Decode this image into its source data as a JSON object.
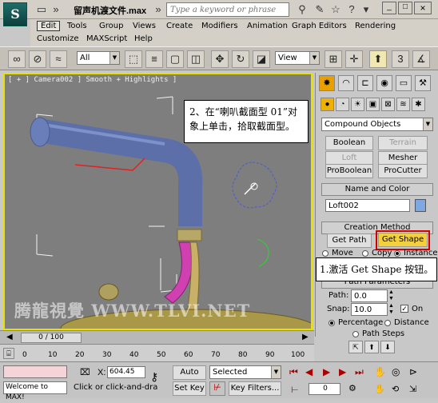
{
  "title_bar": {
    "title": "留声机渡文件.max",
    "search_placeholder": "Type a keyword or phrase"
  },
  "menu": {
    "row1": [
      "Edit",
      "Tools",
      "Group",
      "Views",
      "Create",
      "Modifiers",
      "Animation",
      "Graph Editors",
      "Rendering"
    ],
    "row2": [
      "Customize",
      "MAXScript",
      "Help"
    ]
  },
  "toolbar": {
    "selection_filter": "All",
    "reference_coord": "View"
  },
  "viewport": {
    "label": "[ + ] Camera002 ] Smooth + Highlights ]",
    "callout": "2、在“喇叭截面型 01”对象上单击，拾取截面型。",
    "watermark": "腾龍視覺 WWW.TLVI.NET"
  },
  "command_panel": {
    "category": "Compound Objects",
    "buttons": [
      "Boolean",
      "Terrain",
      "Loft",
      "Mesher",
      "ProBoolean",
      "ProCutter"
    ],
    "name_color_title": "Name and Color",
    "object_name": "Loft002",
    "object_color": "#7fa7e0",
    "creation_method_title": "Creation Method",
    "get_path": "Get Path",
    "get_shape": "Get Shape",
    "move_label": "Move",
    "copy_label": "Copy",
    "instance_label": "Instance",
    "callout": "1.激活 Get Shape 按钮。",
    "path_params_title": "Path Parameters",
    "path_label": "Path:",
    "path_value": "0.0",
    "snap_label": "Snap:",
    "snap_value": "10.0",
    "on_label": "On",
    "percentage_label": "Percentage",
    "distance_label": "Distance",
    "path_steps_label": "Path Steps"
  },
  "timeline": {
    "frame_display": "0 / 100",
    "ticks": [
      "0",
      "10",
      "20",
      "30",
      "40",
      "50",
      "60",
      "70",
      "80",
      "90",
      "100"
    ]
  },
  "status_bar": {
    "welcome": "Welcome to MAX!",
    "prompt": "Click or click-and-dra",
    "x_label": "X:",
    "x_value": "604.45",
    "auto_key": "Auto Key",
    "key_mode": "Selected",
    "set_key": "Set Key",
    "key_filters": "Key Filters...",
    "frame_value": "0"
  },
  "colors": {
    "viewport_border": "#e8e200",
    "active_button": "#f2d040",
    "highlight_box": "#d40000"
  }
}
